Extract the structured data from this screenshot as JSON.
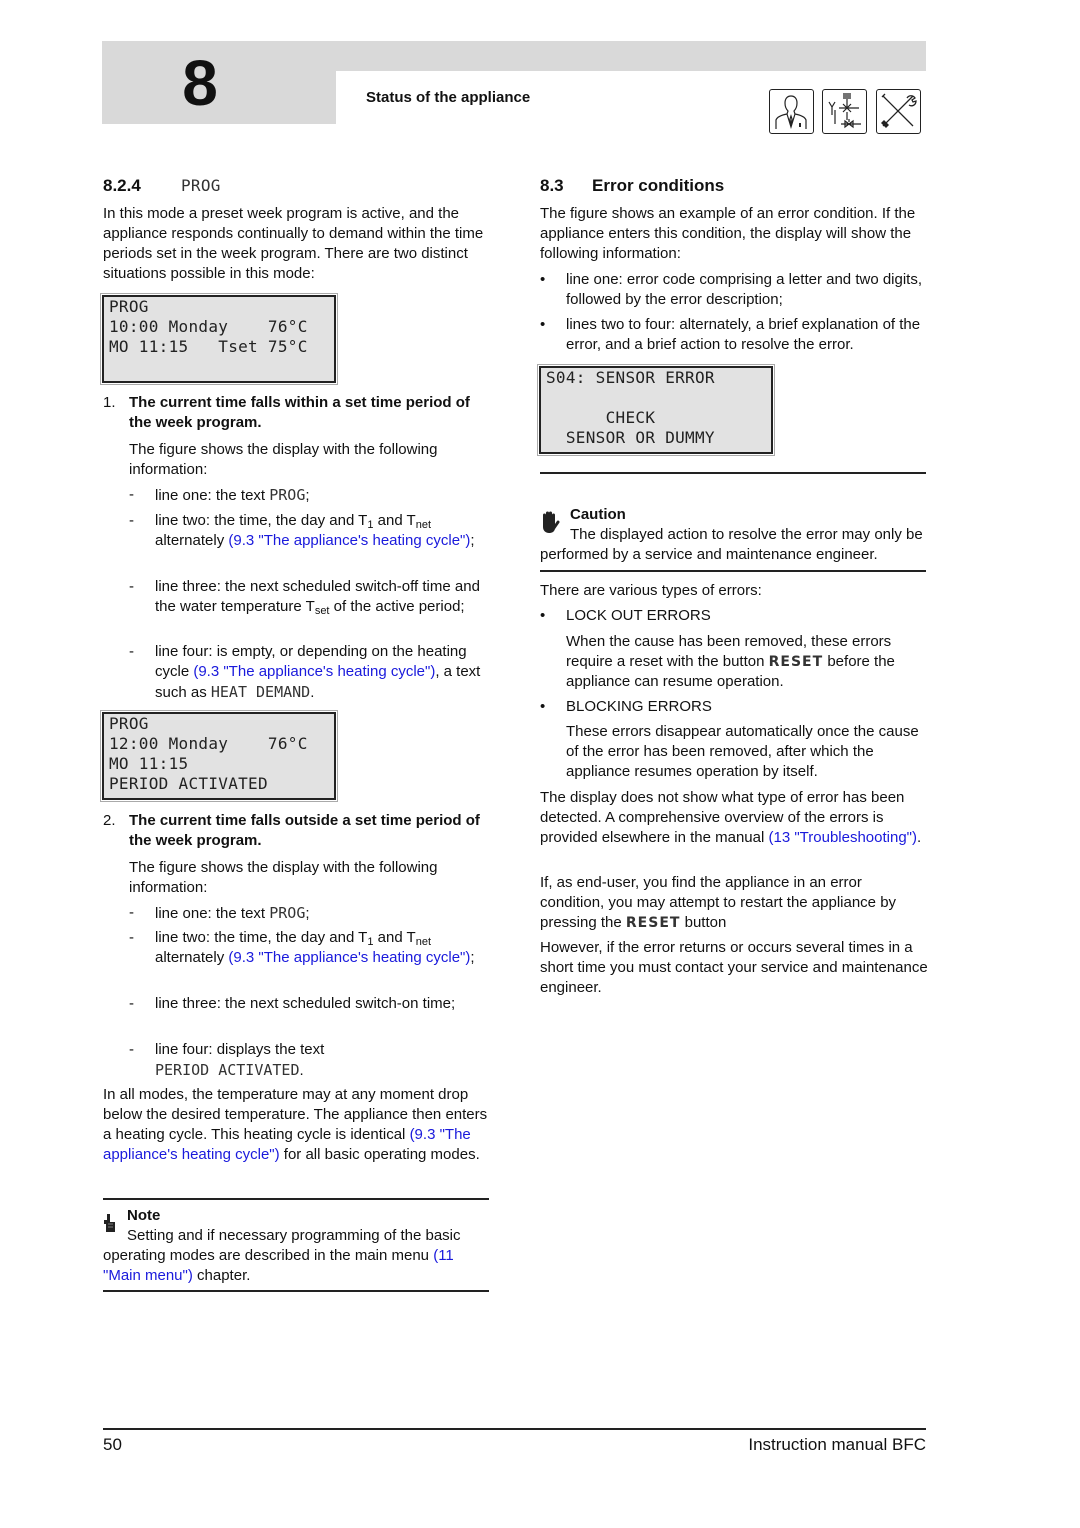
{
  "header": {
    "chapter_number": "8",
    "title": "Status of the appliance",
    "icons": [
      "user-icon",
      "installer-valve-icon",
      "service-tools-icon"
    ]
  },
  "left": {
    "section": {
      "number": "8.2.4",
      "title": "PROG"
    },
    "intro": "In this mode a preset week program is active, and the appliance responds continually to demand within the time periods set in the week program. There are two distinct situations possible in this mode:",
    "display1": {
      "lines": [
        "PROG",
        "10:00 Monday    76°C",
        "MO 11:15   Tset 75°C",
        ""
      ]
    },
    "item1": {
      "number": "1.",
      "title": "The current time falls within a set time period of the week program.",
      "desc": "The figure shows the display with the following information:",
      "dashes": [
        {
          "pre": "line one: the text ",
          "mono": "PROG",
          "post": ";"
        },
        {
          "pre": "line two: the time, the day and T",
          "sub1": "1",
          "mid": " and T",
          "sub2": "net",
          "post": " alternately ",
          "link": "(9.3 \"The appliance's heating cycle\")",
          "end": ";"
        },
        {
          "pre": "line three: the next scheduled switch-off time and the water temperature T",
          "sub1": "set",
          "post": " of the active period;"
        },
        {
          "pre": "line four: is empty, or depending on the heating cycle ",
          "link": "(9.3 \"The appliance's heating cycle\")",
          "post": ", a text such as ",
          "mono": "HEAT DEMAND",
          "end": "."
        }
      ]
    },
    "display2": {
      "lines": [
        "PROG",
        "12:00 Monday    76°C",
        "MO 11:15",
        "PERIOD ACTIVATED"
      ]
    },
    "item2": {
      "number": "2.",
      "title": "The current time falls outside a set time period of the week program.",
      "desc": "The figure shows the display with the following information:",
      "dashes": [
        {
          "pre": "line one: the text ",
          "mono": "PROG",
          "post": ";"
        },
        {
          "pre": "line two: the time, the day and T",
          "sub1": "1",
          "mid": " and T",
          "sub2": "net",
          "post": " alternately ",
          "link": "(9.3 \"The appliance's heating cycle\")",
          "end": ";"
        },
        {
          "pre": "line three: the next scheduled switch-on time;"
        },
        {
          "pre": "line four: displays the text",
          "mono": "PERIOD ACTIVATED",
          "end": "."
        }
      ]
    },
    "all_modes": {
      "pre": "In all modes, the temperature may at any moment drop below the desired temperature. The appliance then enters a heating cycle. This heating cycle is identical ",
      "link": "(9.3 \"The appliance's heating cycle\")",
      "post": " for all basic operating modes."
    },
    "note": {
      "title": "Note",
      "pre": "Setting and if necessary programming of the basic operating modes are described in the main menu ",
      "link": "(11 \"Main menu\")",
      "post": " chapter."
    }
  },
  "right": {
    "section": {
      "number": "8.3",
      "title": "Error conditions"
    },
    "intro": "The figure shows an example of an error condition. If the appliance enters this condition, the display will show the following information:",
    "bullets": [
      "line one: error code comprising a letter and two digits, followed by the error description;",
      "lines two to four: alternately, a brief explanation of the error, and a brief action to resolve the error."
    ],
    "display": {
      "lines": [
        "S04: SENSOR ERROR",
        "",
        "      CHECK",
        "  SENSOR OR DUMMY"
      ]
    },
    "caution": {
      "title": "Caution",
      "text": "The displayed action to resolve the error may only be performed by a service and maintenance engineer."
    },
    "types_intro": "There are various types of errors:",
    "types": [
      {
        "name": "LOCK OUT ERRORS",
        "desc_pre": "When the cause has been removed, these errors require a reset with the button ",
        "button": "RESET",
        "desc_post": " before the appliance can resume operation."
      },
      {
        "name": "BLOCKING ERRORS",
        "desc_pre": "These errors disappear automatically once the cause of the error has been removed, after which the appliance resumes operation by itself."
      }
    ],
    "overview": {
      "pre": "The display does not show what type of error has been detected. A comprehensive overview of the errors is provided elsewhere in the manual ",
      "link": "(13 \"Troubleshooting\")",
      "post": "."
    },
    "end_user": {
      "pre": "If, as end-user, you find the appliance in an error condition, you may attempt to restart the appliance by pressing the ",
      "button": "RESET",
      "post": " button"
    },
    "however": "However, if the error returns or occurs several times in a short time you must contact your service and maintenance engineer."
  },
  "footer": {
    "page_number": "50",
    "manual_title": "Instruction manual BFC"
  }
}
